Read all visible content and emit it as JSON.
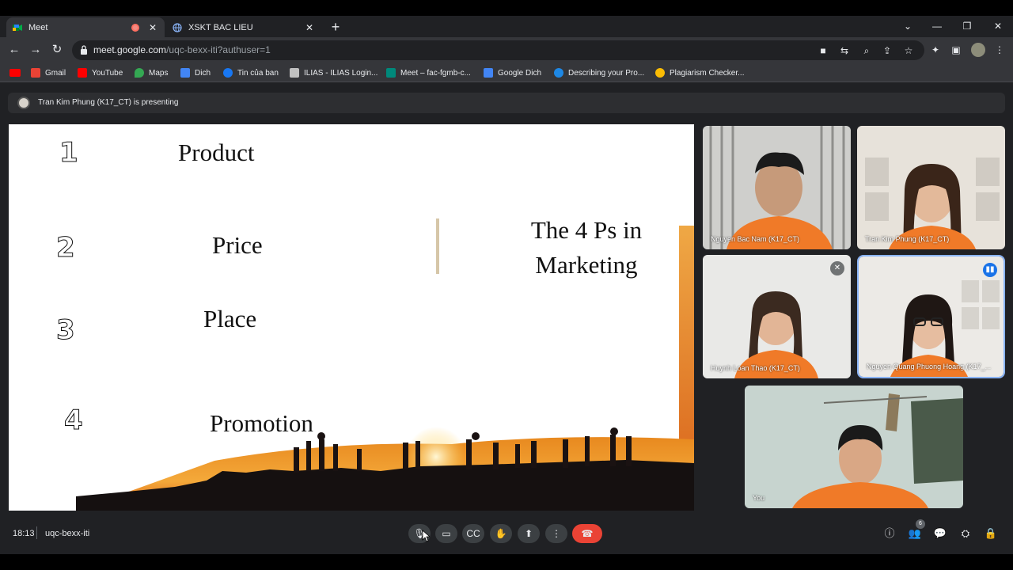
{
  "browser": {
    "tabs": [
      {
        "title": "Meet",
        "active": true
      },
      {
        "title": "XSKT BAC LIEU",
        "active": false
      }
    ],
    "url_host": "meet.google.com",
    "url_path": "/uqc-bexx-iti?authuser=1",
    "bookmarks": [
      {
        "label": "Gmail",
        "color": "#ea4335"
      },
      {
        "label": "YouTube",
        "color": "#ff0000"
      },
      {
        "label": "Maps",
        "color": "#34a853"
      },
      {
        "label": "Dich",
        "color": "#4285f4"
      },
      {
        "label": "Tin của ban",
        "color": "#1877f2"
      },
      {
        "label": "ILIAS - ILIAS Login...",
        "color": "#c0c0c0"
      },
      {
        "label": "Meet – fac-fgmb-c...",
        "color": "#00897b"
      },
      {
        "label": "Google Dich",
        "color": "#4285f4"
      },
      {
        "label": "Describing your Pro...",
        "color": "#1e88e5"
      },
      {
        "label": "Plagiarism Checker...",
        "color": "#fbbc04"
      }
    ]
  },
  "meet": {
    "presenting_text": "Tran Kim Phung (K17_CT) is presenting",
    "slide": {
      "numbers": [
        "1",
        "2",
        "3",
        "4"
      ],
      "items": [
        "Product",
        "Price",
        "Place",
        "Promotion"
      ],
      "title_line1": "The 4 Ps in",
      "title_line2": "Marketing"
    },
    "participants": [
      {
        "name": "Nguyen Bac Nam (K17_CT)"
      },
      {
        "name": "Tran Kim Phung (K17_CT)"
      },
      {
        "name": "Huynh Loan Thao (K17_CT)",
        "muted": true
      },
      {
        "name": "Nguyen Quang Phuong Hoang (K17_...",
        "speaking": true
      },
      {
        "name": "You"
      }
    ],
    "time": "18:13",
    "meeting_code": "uqc-bexx-iti",
    "people_count": "6"
  },
  "colors": {
    "end_call": "#ea4335",
    "speaking_outline": "#8ab4f8",
    "shirt_orange": "#f07a28"
  }
}
